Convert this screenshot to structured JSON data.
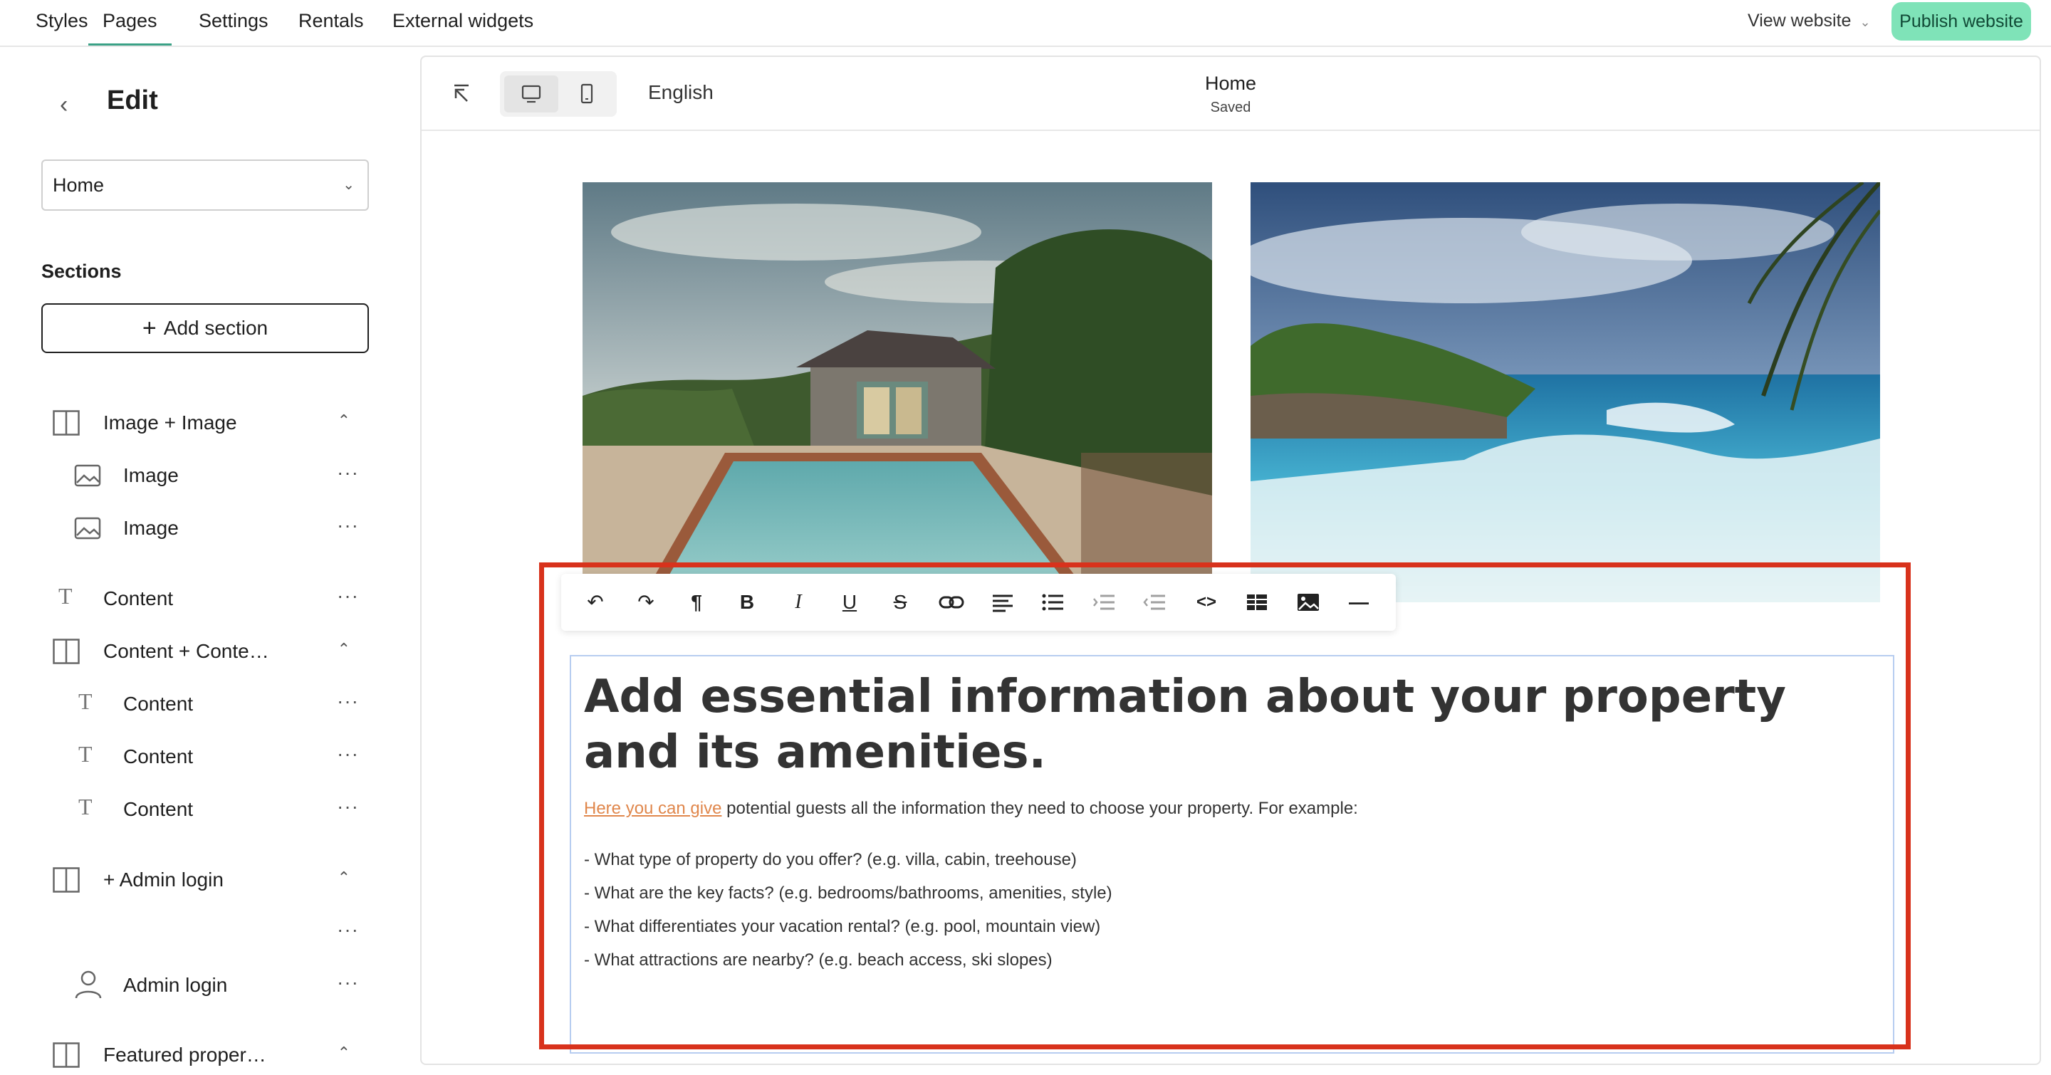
{
  "topnav": {
    "tabs": [
      {
        "label": "Styles"
      },
      {
        "label": "Pages"
      },
      {
        "label": "Settings"
      },
      {
        "label": "Rentals"
      },
      {
        "label": "External widgets"
      }
    ],
    "active_tab": "Pages",
    "view_website": "View website",
    "publish": "Publish website",
    "accent_color": "#3aa186",
    "publish_color": "#7fe3b8"
  },
  "sidebar": {
    "title": "Edit",
    "page_select": "Home",
    "sections_heading": "Sections",
    "add_section": "Add section",
    "items": [
      {
        "label": "Image + Image",
        "icon": "columns-icon"
      },
      {
        "label": "Image",
        "icon": "image-icon"
      },
      {
        "label": "Image",
        "icon": "image-icon"
      },
      {
        "label": "Content",
        "icon": "text-icon"
      },
      {
        "label": "Content + Conte…",
        "icon": "columns-icon"
      },
      {
        "label": "Content",
        "icon": "text-icon"
      },
      {
        "label": "Content",
        "icon": "text-icon"
      },
      {
        "label": "Content",
        "icon": "text-icon"
      },
      {
        "label": "+ Admin login",
        "icon": "columns-icon"
      },
      {
        "label": "",
        "icon": ""
      },
      {
        "label": "Admin login",
        "icon": "user-icon"
      },
      {
        "label": "Featured proper…",
        "icon": "columns-icon"
      }
    ],
    "more_glyph": "···",
    "chevron_up": "⌃"
  },
  "editor": {
    "language": "English",
    "page_title": "Home",
    "save_status": "Saved",
    "headline": "Add essential information about your property and its amenities.",
    "intro_link": "Here you can give",
    "intro_rest": " potential guests all the information they need to choose your property. For example:",
    "bullets": [
      "- What type of property do you offer? (e.g. villa, cabin, treehouse)",
      "- What are the key facts? (e.g. bedrooms/bathrooms, amenities, style)",
      "- What differentiates your vacation rental? (e.g. pool, mountain view)",
      "- What attractions are nearby? (e.g. beach access, ski slopes)"
    ],
    "link_color": "#e0874c",
    "highlight_color": "#d8321c"
  },
  "toolbar": {
    "undo": "↶",
    "redo": "↷",
    "paragraph": "¶",
    "bold": "B",
    "italic": "I",
    "underline": "U",
    "strike": "S",
    "code": "<>",
    "rule": "—"
  }
}
